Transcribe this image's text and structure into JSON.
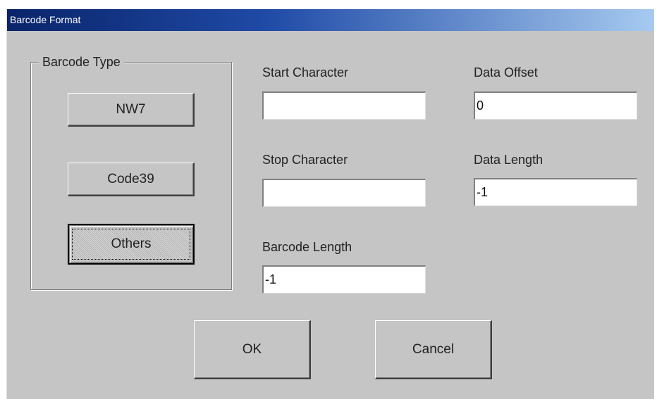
{
  "window": {
    "title": "Barcode Format"
  },
  "barcode_type": {
    "legend": "Barcode Type",
    "buttons": {
      "nw7": "NW7",
      "code39": "Code39",
      "others": "Others"
    },
    "selected": "Others"
  },
  "fields": {
    "start_character": {
      "label": "Start Character",
      "value": ""
    },
    "stop_character": {
      "label": "Stop Character",
      "value": ""
    },
    "barcode_length": {
      "label": "Barcode Length",
      "value": "-1"
    },
    "data_offset": {
      "label": "Data Offset",
      "value": "0"
    },
    "data_length": {
      "label": "Data Length",
      "value": "-1"
    }
  },
  "actions": {
    "ok": "OK",
    "cancel": "Cancel"
  }
}
